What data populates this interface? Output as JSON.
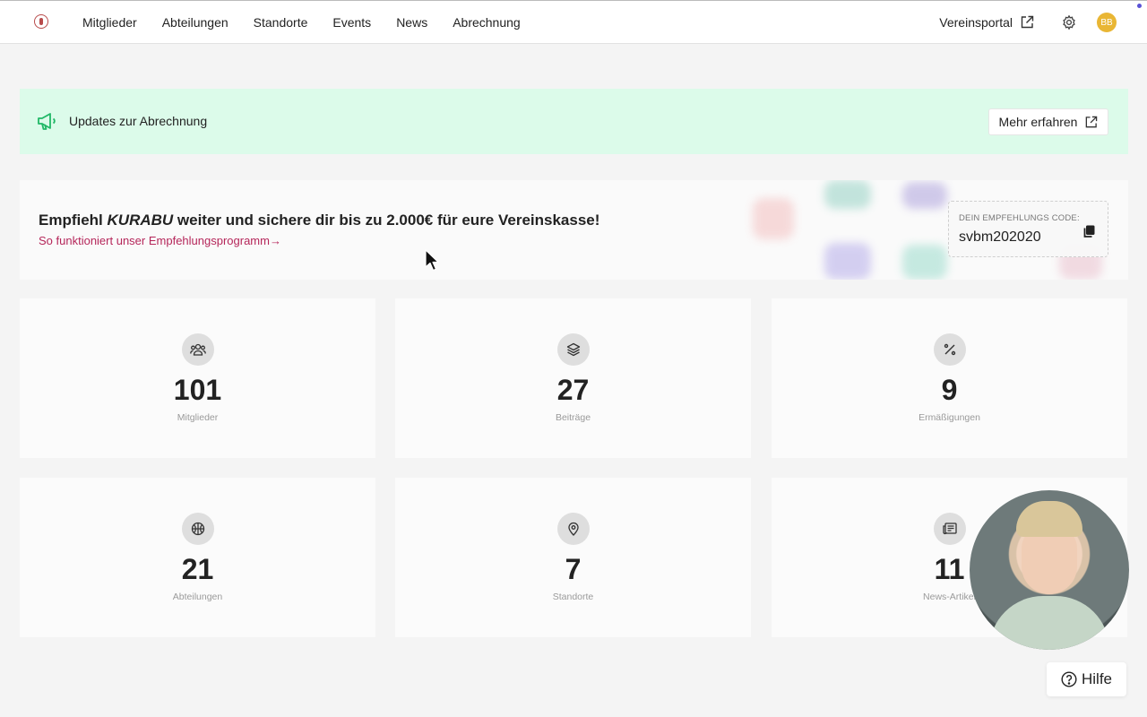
{
  "nav": {
    "items": [
      "Mitglieder",
      "Abteilungen",
      "Standorte",
      "Events",
      "News",
      "Abrechnung"
    ],
    "portal_label": "Vereinsportal",
    "avatar_initials": "BB"
  },
  "banner": {
    "text": "Updates zur Abrechnung",
    "button_label": "Mehr erfahren"
  },
  "referral": {
    "title_before": "Empfiehl ",
    "title_brand": "KURABU",
    "title_after": " weiter und sichere dir bis zu 2.000€ für eure Vereinskasse!",
    "link_text": "So funktioniert unser Empfehlungsprogramm",
    "code_label": "DEIN EMPFEHLUNGS CODE:",
    "code_value": "svbm202020"
  },
  "stats": [
    {
      "value": "101",
      "label": "Mitglieder",
      "icon": "users-icon"
    },
    {
      "value": "27",
      "label": "Beiträge",
      "icon": "layers-icon"
    },
    {
      "value": "9",
      "label": "Ermäßigungen",
      "icon": "percent-icon"
    },
    {
      "value": "21",
      "label": "Abteilungen",
      "icon": "ball-icon"
    },
    {
      "value": "7",
      "label": "Standorte",
      "icon": "map-pin-icon"
    },
    {
      "value": "11",
      "label": "News-Artikel",
      "icon": "newspaper-icon"
    }
  ],
  "help": {
    "label": "Hilfe"
  },
  "colors": {
    "banner_bg": "#dcfbea",
    "banner_icon": "#21b867",
    "link": "#b5265a",
    "avatar": "#e9b634"
  }
}
